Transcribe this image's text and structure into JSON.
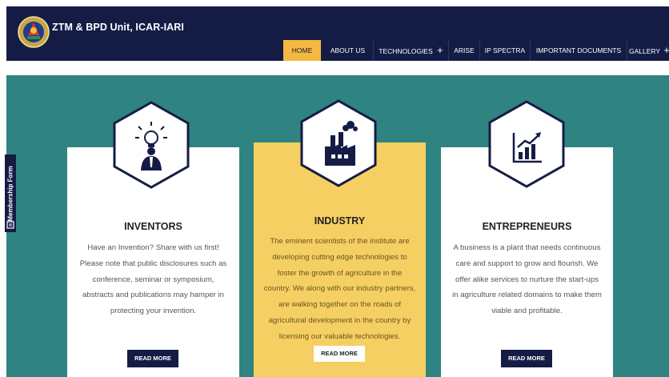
{
  "site": {
    "title": "ZTM & BPD Unit, ICAR-IARI"
  },
  "nav": {
    "items": [
      {
        "label": "HOME"
      },
      {
        "label": "ABOUT US"
      },
      {
        "label": "TECHNOLOGIES"
      },
      {
        "label": "ARISE"
      },
      {
        "label": "IP SPECTRA"
      },
      {
        "label": "IMPORTANT DOCUMENTS"
      },
      {
        "label": "GALLERY"
      }
    ],
    "expand_symbol": "+"
  },
  "side_tab": {
    "label": "Membership Form"
  },
  "cards": [
    {
      "title": "INVENTORS",
      "lines": [
        "Have an Invention? Share with us first!",
        "Please note that public disclosures such as",
        "conference, seminar or symposium,",
        "abstracts and publications may hamper in",
        "protecting your invention."
      ],
      "button": "READ MORE",
      "icon": "inventor-lightbulb-icon"
    },
    {
      "title": "INDUSTRY",
      "lines": [
        "The eminent scientists of the institute are",
        "developing cutting edge technologies to",
        "foster the growth of agriculture in the",
        "country. We along with our industry partners,",
        "are walking together on the roads of",
        "agricultural development in the country by",
        "licensing our valuable technologies."
      ],
      "button": "READ MORE",
      "icon": "factory-icon"
    },
    {
      "title": "ENTREPRENEURS",
      "lines": [
        "A business is a plant that needs continuous",
        "care and support to grow and flourish. We",
        "offer alike services to nurture the start-ups",
        "in agriculture related domains to make them",
        "viable and profitable."
      ],
      "button": "READ MORE",
      "icon": "growth-chart-icon"
    }
  ],
  "colors": {
    "navy": "#141c46",
    "teal": "#2f8381",
    "accent": "#f4b942",
    "card_highlight": "#f6cf62"
  }
}
